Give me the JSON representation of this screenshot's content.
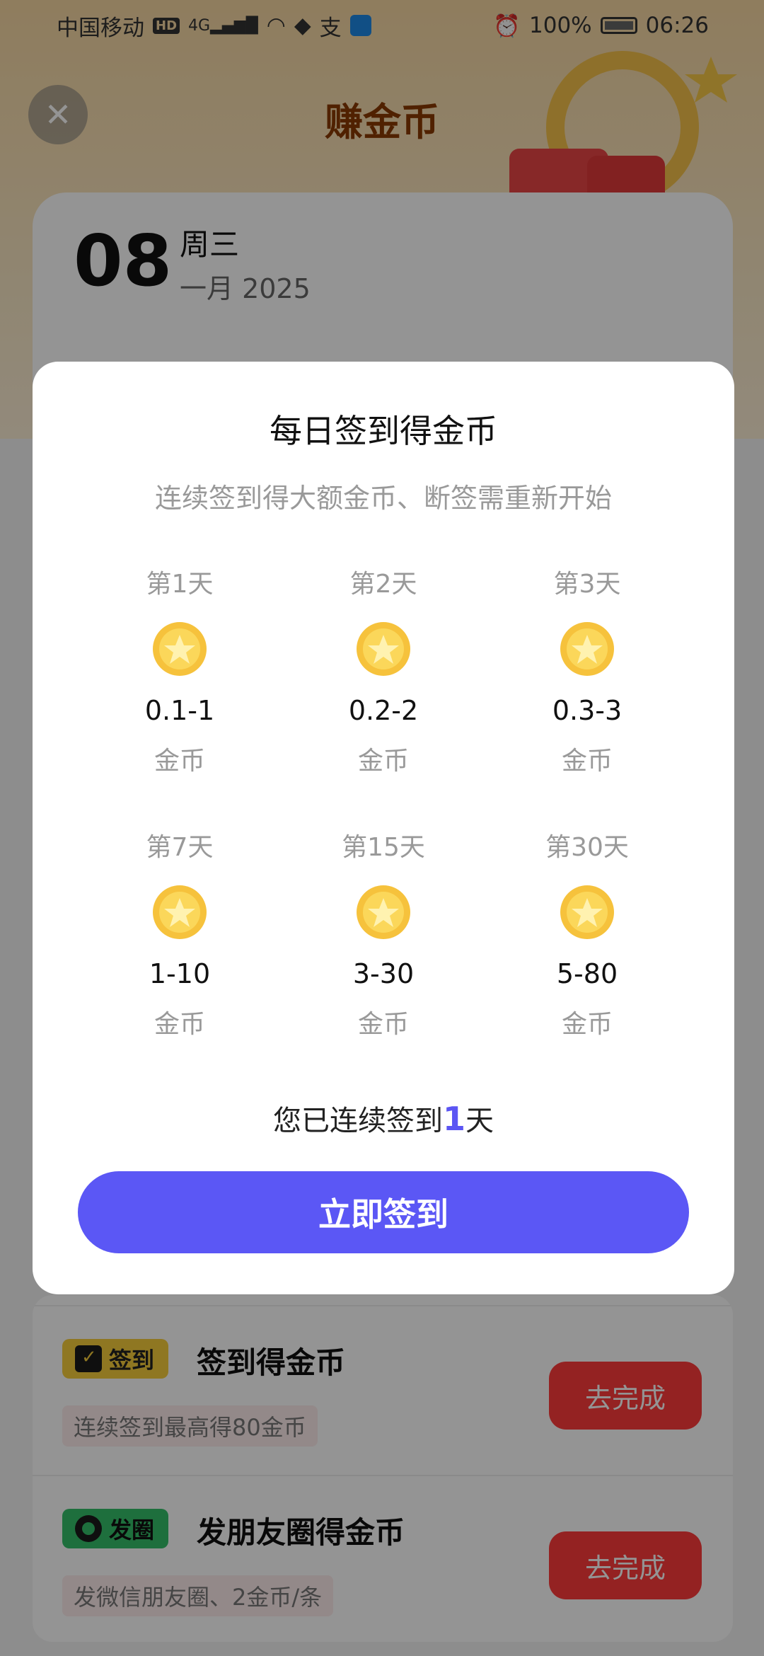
{
  "status_bar": {
    "carrier": "中国移动",
    "hd": "HD",
    "network": "4G",
    "battery": "100%",
    "time": "06:26"
  },
  "header": {
    "title": "赚金币",
    "close_icon": "close-icon"
  },
  "date_card": {
    "day": "08",
    "weekday": "周三",
    "month_year": "一月 2025"
  },
  "modal": {
    "title": "每日签到得金币",
    "subtitle": "连续签到得大额金币、断签需重新开始",
    "rewards": [
      {
        "day": "第1天",
        "amount": "0.1-1",
        "unit": "金币"
      },
      {
        "day": "第2天",
        "amount": "0.2-2",
        "unit": "金币"
      },
      {
        "day": "第3天",
        "amount": "0.3-3",
        "unit": "金币"
      },
      {
        "day": "第7天",
        "amount": "1-10",
        "unit": "金币"
      },
      {
        "day": "第15天",
        "amount": "3-30",
        "unit": "金币"
      },
      {
        "day": "第30天",
        "amount": "5-80",
        "unit": "金币"
      }
    ],
    "streak_prefix": "您已连续签到",
    "streak_days": "1",
    "streak_suffix": "天",
    "button_label": "立即签到",
    "accent_color": "#5b57f5"
  },
  "tasks": [
    {
      "tag": "签到",
      "tag_icon": "calendar-check-icon",
      "title": "签到得金币",
      "subtitle": "连续签到最高得80金币",
      "button": "去完成"
    },
    {
      "tag": "发圈",
      "tag_icon": "camera-icon",
      "title": "发朋友圈得金币",
      "subtitle": "发微信朋友圈、2金币/条",
      "button": "去完成"
    }
  ]
}
